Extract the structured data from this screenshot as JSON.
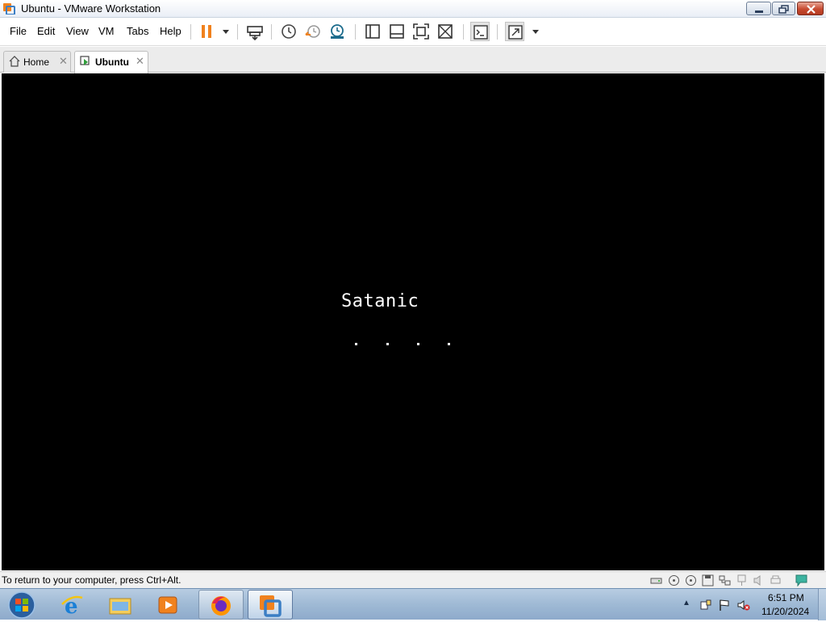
{
  "window": {
    "title": "Ubuntu - VMware Workstation"
  },
  "menu": {
    "items": [
      "File",
      "Edit",
      "View",
      "VM",
      "Tabs",
      "Help"
    ]
  },
  "tabs": [
    {
      "label": "Home",
      "active": false
    },
    {
      "label": "Ubuntu",
      "active": true
    }
  ],
  "vm_console": {
    "text": "Satanic",
    "dots": 4,
    "background": "#000000"
  },
  "statusbar": {
    "message": "To return to your computer, press Ctrl+Alt."
  },
  "taskbar": {
    "pinned": [
      "internet-explorer-icon",
      "windows-explorer-icon",
      "media-player-icon",
      "firefox-icon",
      "vmware-workstation-icon"
    ],
    "clock": {
      "time": "6:51 PM",
      "date": "11/20/2024"
    }
  },
  "colors": {
    "accent_orange": "#f0821e",
    "vm_background": "#000000",
    "taskbar": "#9fbad5"
  }
}
